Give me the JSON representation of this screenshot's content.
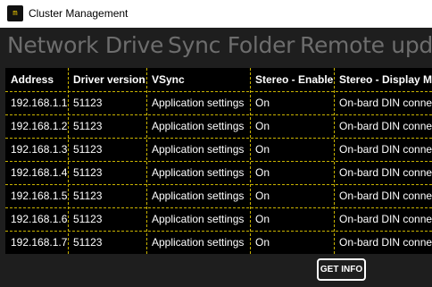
{
  "window": {
    "title": "Cluster Management",
    "icon": "app-logo-icon"
  },
  "tabs": [
    {
      "label": "Network Drive"
    },
    {
      "label": "Sync Folder"
    },
    {
      "label": "Remote updat"
    }
  ],
  "table": {
    "columns": [
      "Address",
      "Driver version",
      "VSync",
      "Stereo - Enable",
      "Stereo - Display M"
    ],
    "rows": [
      [
        "192.168.1.1",
        "51123",
        "Application settings",
        "On",
        "On-bard DIN conne"
      ],
      [
        "192.168.1.2",
        "51123",
        "Application settings",
        "On",
        "On-bard DIN conne"
      ],
      [
        "192.168.1.3",
        "51123",
        "Application settings",
        "On",
        "On-bard DIN conne"
      ],
      [
        "192.168.1.4",
        "51123",
        "Application settings",
        "On",
        "On-bard DIN conne"
      ],
      [
        "192.168.1.5",
        "51123",
        "Application settings",
        "On",
        "On-bard DIN conne"
      ],
      [
        "192.168.1.6",
        "51123",
        "Application settings",
        "On",
        "On-bard DIN conne"
      ],
      [
        "192.168.1.7",
        "51123",
        "Application settings",
        "On",
        "On-bard DIN conne"
      ]
    ]
  },
  "actions": {
    "get_info_label": "GET INFO"
  },
  "colors": {
    "background": "#1e1e1e",
    "grid_background": "#000000",
    "grid_lines": "#c9b300",
    "tab_text": "#6d6d6d",
    "cell_text": "#ffffff"
  }
}
